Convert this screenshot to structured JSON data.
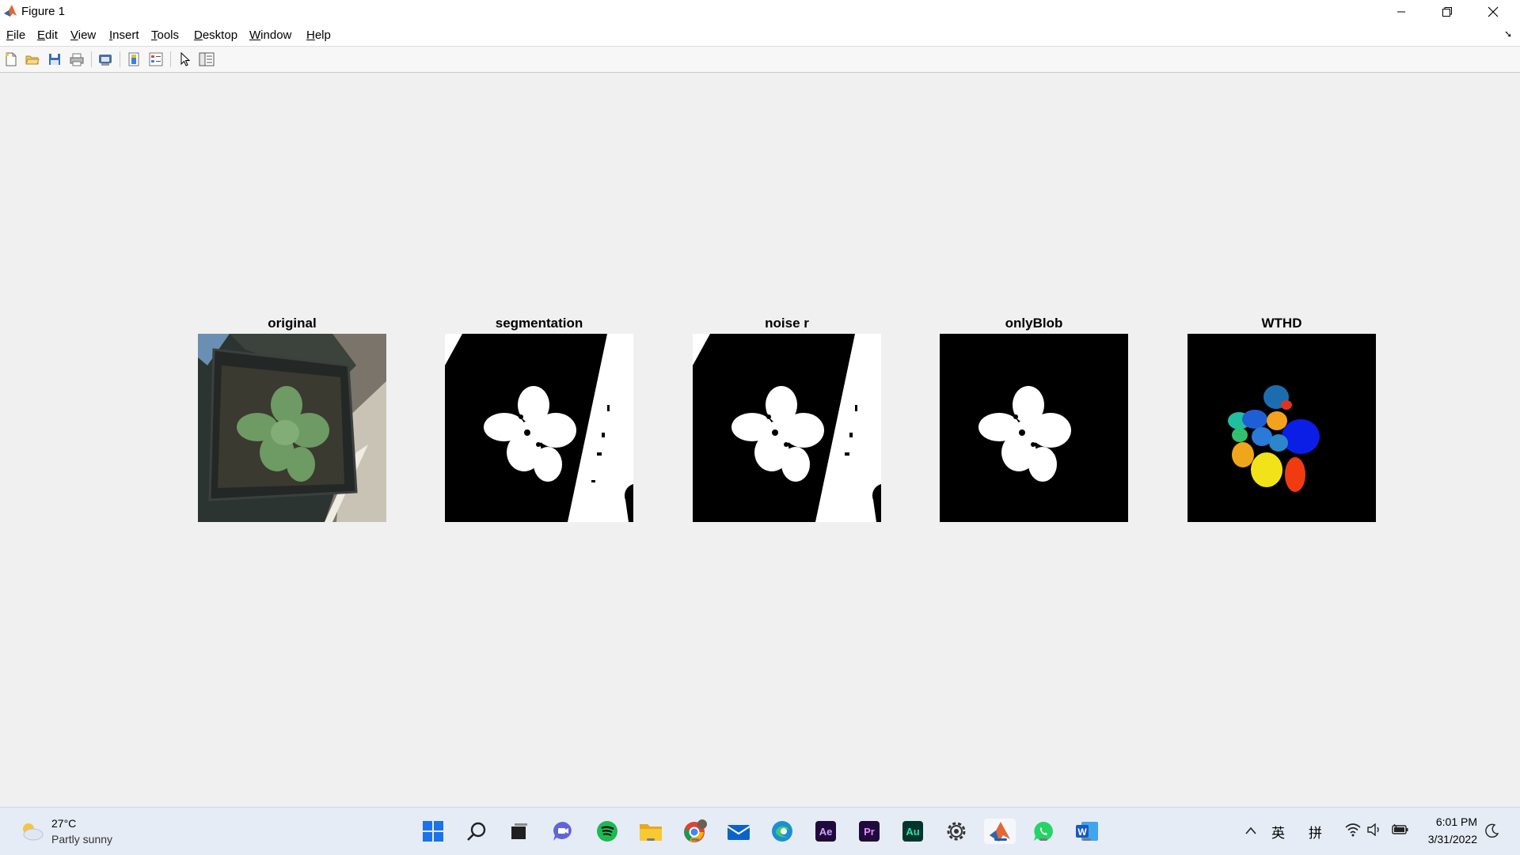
{
  "window": {
    "title": "Figure 1",
    "controls": [
      "minimize",
      "restore",
      "close"
    ]
  },
  "menu": {
    "items": [
      {
        "label": "File",
        "key": "F",
        "rest": "ile"
      },
      {
        "label": "Edit",
        "key": "E",
        "rest": "dit"
      },
      {
        "label": "View",
        "key": "V",
        "rest": "iew"
      },
      {
        "label": "Insert",
        "key": "I",
        "rest": "nsert"
      },
      {
        "label": "Tools",
        "key": "T",
        "rest": "ools"
      },
      {
        "label": "Desktop",
        "key": "D",
        "rest": "esktop"
      },
      {
        "label": "Window",
        "key": "W",
        "rest": "indow"
      },
      {
        "label": "Help",
        "key": "H",
        "rest": "elp"
      }
    ]
  },
  "toolbar": {
    "icons": [
      "new-figure-icon",
      "open-file-icon",
      "save-icon",
      "print-icon",
      "print-preview-icon",
      "colorbar-icon",
      "legend-icon",
      "edit-pointer-icon",
      "property-inspector-icon"
    ]
  },
  "figure": {
    "subplots": [
      {
        "title": "original"
      },
      {
        "title": "segmentation"
      },
      {
        "title": "noise r"
      },
      {
        "title": "onlyBlob"
      },
      {
        "title": "WTHD"
      }
    ]
  },
  "taskbar": {
    "weather": {
      "temp": "27°C",
      "desc": "Partly sunny"
    },
    "apps": [
      "windows-start-icon",
      "search-icon",
      "task-view-icon",
      "teams-chat-icon",
      "spotify-icon",
      "file-explorer-icon",
      "chrome-icon",
      "mail-icon",
      "edge-icon",
      "after-effects-icon",
      "premiere-icon",
      "audition-icon",
      "settings-icon",
      "matlab-icon",
      "whatsapp-icon",
      "word-icon"
    ],
    "app_labels": {
      "ae": "Ae",
      "pr": "Pr",
      "au": "Au",
      "word": "W"
    },
    "tray": {
      "ime1": "英",
      "ime2": "拼"
    },
    "clock": {
      "time": "6:01 PM",
      "date": "3/31/2022"
    }
  },
  "colors": {
    "matlab_orange": "#e16737",
    "taskbar_bg": "#e6ecf5",
    "figure_bg": "#f0f0f0"
  }
}
